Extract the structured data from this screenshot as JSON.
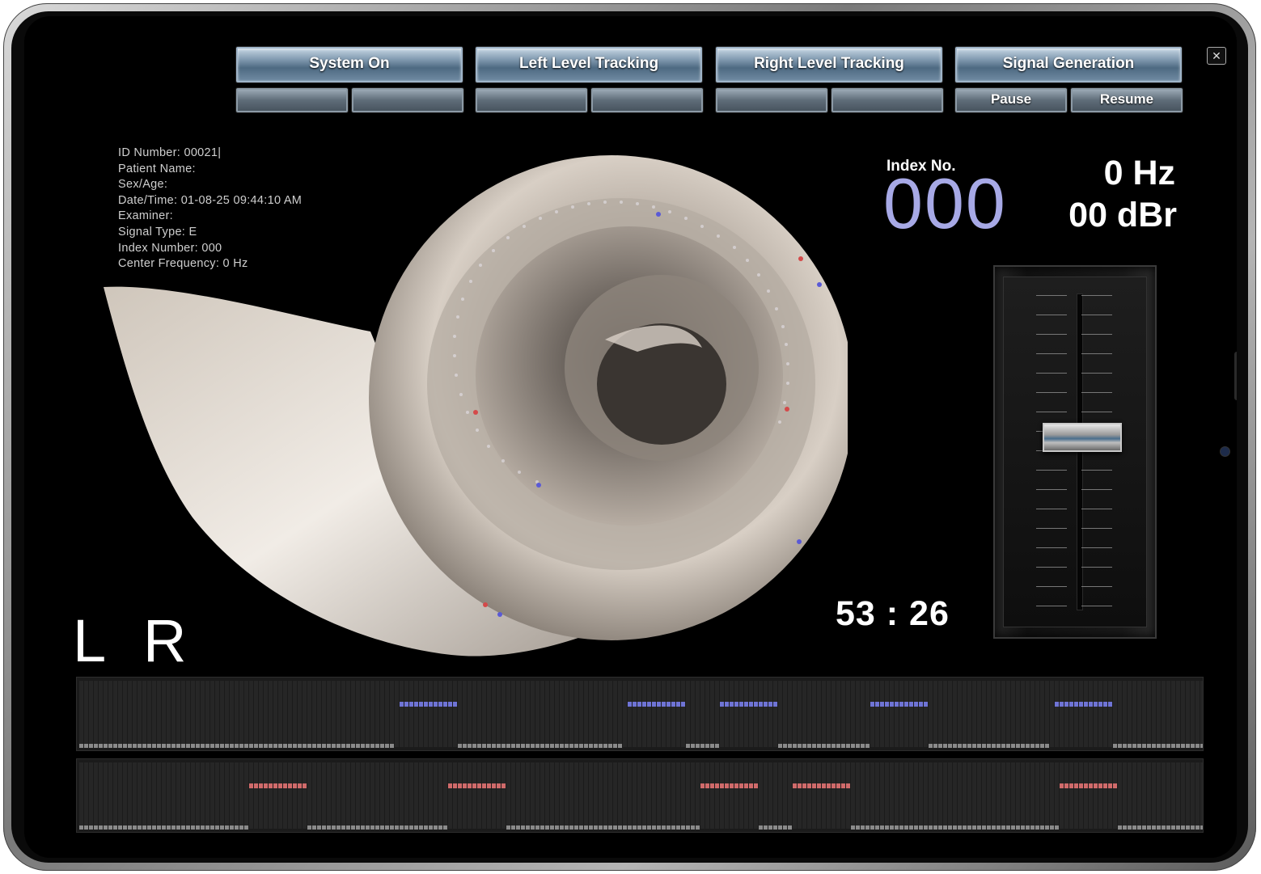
{
  "controls": {
    "system_on": "System On",
    "left_level_tracking": "Left Level Tracking",
    "right_level_tracking": "Right Level Tracking",
    "signal_generation": "Signal Generation",
    "pause": "Pause",
    "resume": "Resume",
    "close_glyph": "✕"
  },
  "info": {
    "id_number": "ID Number: 00021|",
    "patient_name": "Patient Name:",
    "sex_age": "Sex/Age:",
    "date_time": "Date/Time: 01-08-25 09:44:10 AM",
    "examiner": "Examiner:",
    "signal_type": "Signal Type: E",
    "index_number": "Index Number: 000",
    "center_frequency": "Center Frequency: 0 Hz"
  },
  "readout": {
    "index_label": "Index No.",
    "index_value": "000",
    "frequency": "0 Hz",
    "level": "00 dBr",
    "timer": "53 : 26",
    "channels": "L R"
  },
  "fader": {
    "level_fraction": 0.55
  },
  "colors": {
    "index_value": "#a7a9e6",
    "left_meter": "#6f74d6",
    "right_meter": "#d06a6a",
    "button": "#6f8aa2"
  }
}
